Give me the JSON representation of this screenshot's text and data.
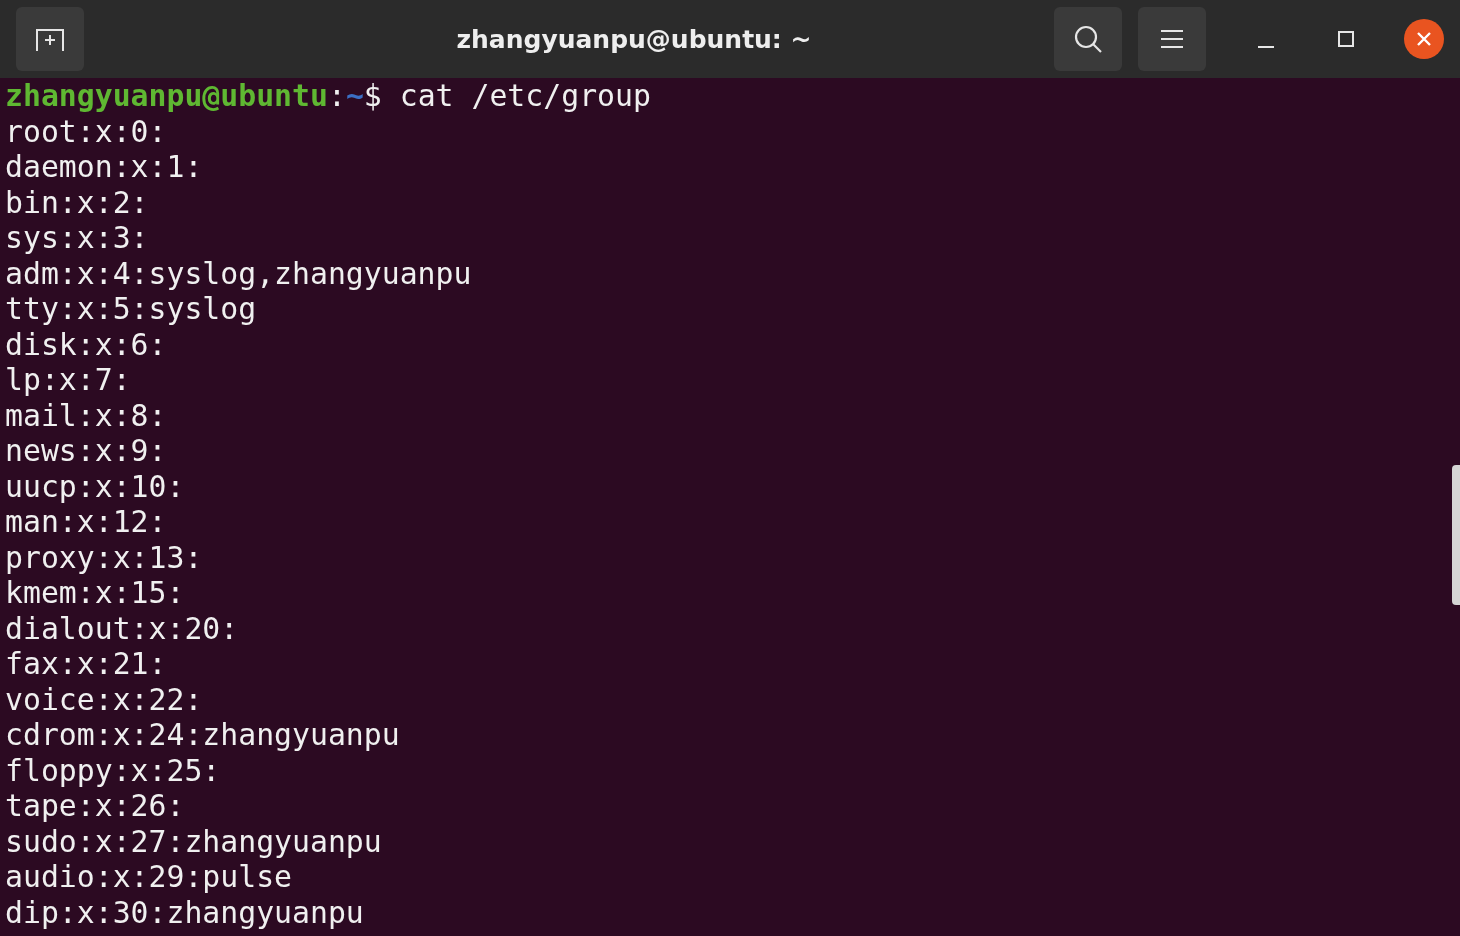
{
  "window": {
    "title": "zhangyuanpu@ubuntu: ~"
  },
  "prompt": {
    "user_host": "zhangyuanpu@ubuntu",
    "separator": ":",
    "path": "~",
    "symbol": "$",
    "command": "cat /etc/group"
  },
  "output": [
    "root:x:0:",
    "daemon:x:1:",
    "bin:x:2:",
    "sys:x:3:",
    "adm:x:4:syslog,zhangyuanpu",
    "tty:x:5:syslog",
    "disk:x:6:",
    "lp:x:7:",
    "mail:x:8:",
    "news:x:9:",
    "uucp:x:10:",
    "man:x:12:",
    "proxy:x:13:",
    "kmem:x:15:",
    "dialout:x:20:",
    "fax:x:21:",
    "voice:x:22:",
    "cdrom:x:24:zhangyuanpu",
    "floppy:x:25:",
    "tape:x:26:",
    "sudo:x:27:zhangyuanpu",
    "audio:x:29:pulse",
    "dip:x:30:zhangyuanpu"
  ]
}
